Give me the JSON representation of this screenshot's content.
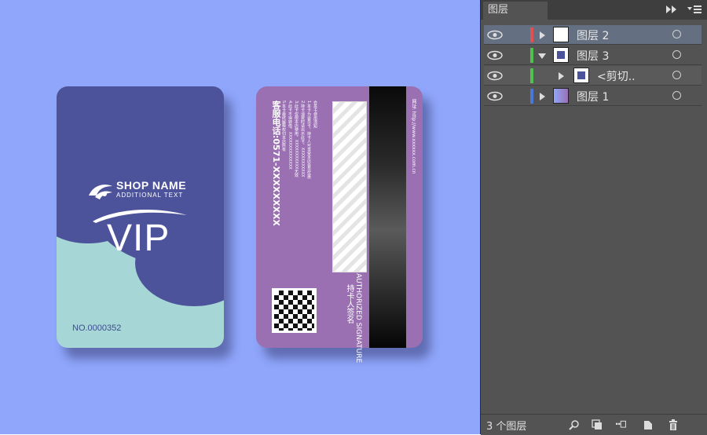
{
  "canvas": {
    "front_card": {
      "shop_name": "SHOP NAME",
      "additional_text": "ADDITIONAL TEXT",
      "vip": "VIP",
      "card_number": "NO.0000352"
    },
    "back_card": {
      "service_phone": "客服电话:0571-XXXXXXXXX",
      "website": "网址: http://www.xxxxxx.com.cn",
      "authorized_signature": "AUTHORIZED SIGNATURE",
      "holder_signature_cn": "持卡人签名",
      "instructions": [
        "会员卡使用须知",
        "1.本卡为会员卡，持卡人可享受本店会员优惠",
        "2.持卡消费时请出示此卡，XXXXXXXXXXX",
        "3.此卡仅限本店使用，XXXXXXXXXXX无效",
        "4.此卡不得转借，XXXXXXXXXXXXXX",
        "5.本卡最终解释权归本店所有"
      ]
    }
  },
  "layers_panel": {
    "tab_title": "图层",
    "layers": [
      {
        "name": "图层 2",
        "color": "#e05252",
        "expanded": false,
        "indent": 0,
        "selected": true
      },
      {
        "name": "图层 3",
        "color": "#4fc14f",
        "expanded": true,
        "indent": 0,
        "selected": false
      },
      {
        "name": "<剪切..",
        "color": "#4fc14f",
        "expanded": false,
        "indent": 1,
        "selected": false
      },
      {
        "name": "图层 1",
        "color": "#4a78d8",
        "expanded": false,
        "indent": 0,
        "selected": false
      }
    ],
    "footer_text": "3 个图层",
    "icons": [
      "fast-forward-icon",
      "panel-menu-icon",
      "search-icon",
      "make-clipping-mask-icon",
      "new-sublayer-icon",
      "new-layer-icon",
      "trash-icon"
    ]
  }
}
